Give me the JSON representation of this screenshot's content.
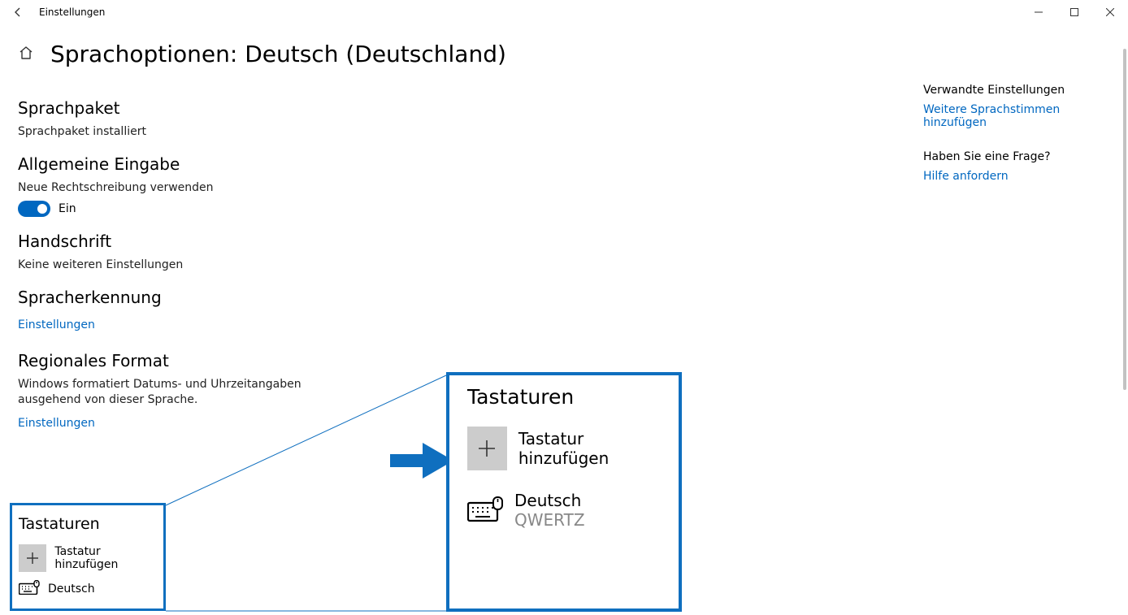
{
  "window": {
    "app_title": "Einstellungen"
  },
  "header": {
    "title": "Sprachoptionen: Deutsch (Deutschland)"
  },
  "sections": {
    "language_pack": {
      "title": "Sprachpaket",
      "status": "Sprachpaket installiert"
    },
    "general_typing": {
      "title": "Allgemeine Eingabe",
      "spellcheck_label": "Neue Rechtschreibung verwenden",
      "toggle_text": "Ein"
    },
    "handwriting": {
      "title": "Handschrift",
      "status": "Keine weiteren Einstellungen"
    },
    "speech": {
      "title": "Spracherkennung",
      "link": "Einstellungen"
    },
    "regional": {
      "title": "Regionales Format",
      "desc": "Windows formatiert Datums- und Uhrzeitangaben ausgehend von dieser Sprache.",
      "link": "Einstellungen"
    },
    "keyboards": {
      "title": "Tastaturen",
      "add_label": "Tastatur hinzufügen",
      "entry_name": "Deutsch",
      "entry_layout": "QWERTZ"
    }
  },
  "side": {
    "related_h": "Verwandte Einstellungen",
    "related_link": "Weitere Sprachstimmen hinzufügen",
    "help_h": "Haben Sie eine Frage?",
    "help_link": "Hilfe anfordern"
  },
  "colors": {
    "accent": "#0067c0",
    "highlight": "#0f6fbf"
  }
}
